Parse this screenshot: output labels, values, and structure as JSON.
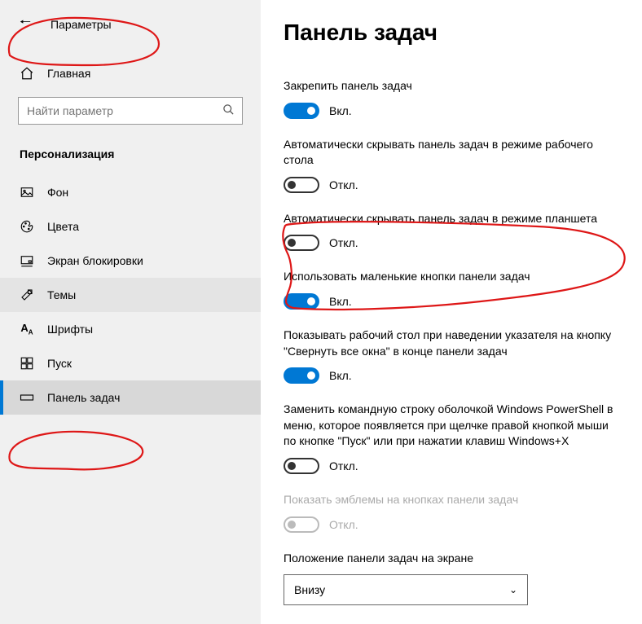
{
  "header": {
    "title": "Параметры"
  },
  "home": {
    "label": "Главная"
  },
  "search": {
    "placeholder": "Найти параметр"
  },
  "section": {
    "title": "Персонализация"
  },
  "nav": {
    "background": "Фон",
    "colors": "Цвета",
    "lockscreen": "Экран блокировки",
    "themes": "Темы",
    "fonts": "Шрифты",
    "start": "Пуск",
    "taskbar": "Панель задач"
  },
  "main": {
    "title": "Панель задач"
  },
  "settings": {
    "lock_taskbar": {
      "label": "Закрепить панель задач",
      "state": "Вкл."
    },
    "autohide_desktop": {
      "label": "Автоматически скрывать панель задач в режиме рабочего стола",
      "state": "Откл."
    },
    "autohide_tablet": {
      "label": "Автоматически скрывать панель задач в режиме планшета",
      "state": "Откл."
    },
    "small_buttons": {
      "label": "Использовать маленькие кнопки панели задач",
      "state": "Вкл."
    },
    "peek_desktop": {
      "label": "Показывать рабочий стол при наведении указателя на кнопку \"Свернуть все окна\" в конце панели задач",
      "state": "Вкл."
    },
    "powershell": {
      "label": "Заменить командную строку оболочкой Windows PowerShell в меню, которое появляется при щелчке правой кнопкой мыши по кнопке \"Пуск\" или при нажатии клавиш Windows+X",
      "state": "Откл."
    },
    "badges": {
      "label": "Показать эмблемы на кнопках панели задач",
      "state": "Откл."
    },
    "position": {
      "label": "Положение панели задач на экране",
      "value": "Внизу"
    }
  }
}
